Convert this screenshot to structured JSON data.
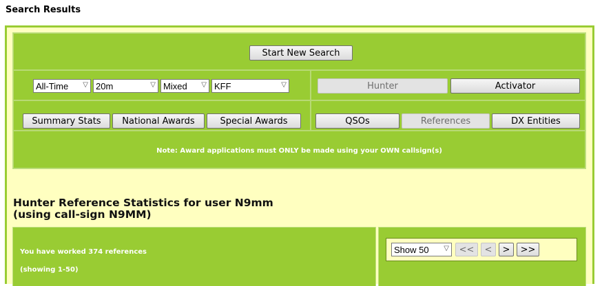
{
  "page": {
    "title": "Search Results"
  },
  "search": {
    "new_search_label": "Start New Search"
  },
  "filters": [
    {
      "value": "All-Time"
    },
    {
      "value": "20m"
    },
    {
      "value": "Mixed"
    },
    {
      "value": "KFF"
    }
  ],
  "role_buttons": {
    "hunter": "Hunter",
    "activator": "Activator"
  },
  "stats_buttons": {
    "summary": "Summary Stats",
    "national": "National Awards",
    "special": "Special Awards"
  },
  "view_buttons": {
    "qsos": "QSOs",
    "references": "References",
    "dx": "DX Entities"
  },
  "note": "Note: Award applications must ONLY be made using your OWN callsign(s)",
  "results": {
    "heading_line1": "Hunter Reference Statistics for user N9mm",
    "heading_line2": "(using call-sign N9MM)",
    "worked": "You have worked 374 references",
    "showing": "(showing 1-50)"
  },
  "pager": {
    "show": "Show 50",
    "first": "<<",
    "prev": "<",
    "next": ">",
    "last": ">>"
  },
  "colors": {
    "accent": "#99cc33",
    "panel": "#ffffc0"
  }
}
